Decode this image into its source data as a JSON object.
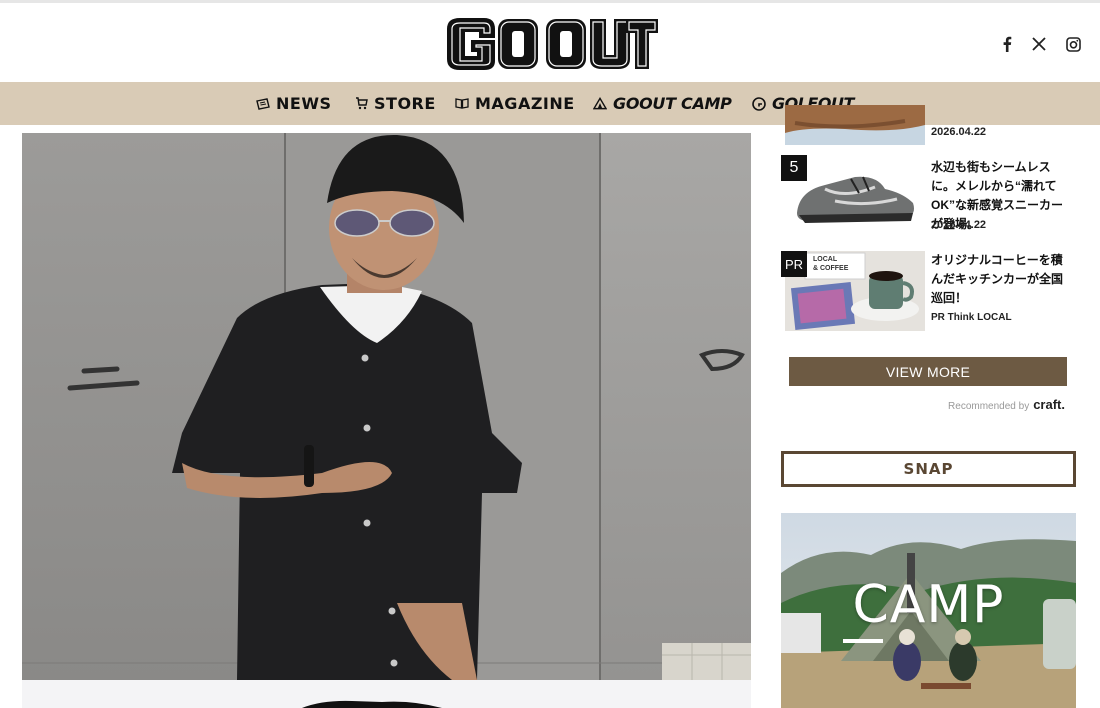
{
  "site": {
    "logo_text": "GO OUT"
  },
  "social": {
    "facebook_icon": "facebook-icon",
    "x_icon": "x-icon",
    "instagram_icon": "instagram-icon"
  },
  "nav": {
    "items": [
      {
        "label": "NEWS",
        "icon": "news-icon"
      },
      {
        "label": "STORE",
        "icon": "cart-icon"
      },
      {
        "label": "MAGAZINE",
        "icon": "book-icon"
      },
      {
        "label": "GOOUT CAMP",
        "icon": "tent-icon"
      },
      {
        "label": "GOLFOUT",
        "icon": "golf-icon"
      }
    ]
  },
  "ranking": {
    "items": [
      {
        "rank": "",
        "title": "",
        "date": "2026.04.22"
      },
      {
        "rank": "5",
        "title": "水辺も街もシームレスに。メレルから“濡れてOK”な新感覚スニーカーが登場。",
        "date": "2026.04.22"
      },
      {
        "rank": "PR",
        "title": "オリジナルコーヒーを積んだキッチンカーが全国巡回！",
        "sponsor": "PR Think LOCAL"
      }
    ],
    "thumb_text": "LOCAL\n& COFFEE"
  },
  "sidebar": {
    "view_more": "VIEW MORE",
    "recommended_by": "Recommended by",
    "craft": "craft.",
    "snap": "SNAP",
    "camp_banner": "CAMP"
  },
  "colors": {
    "nav_bg": "#d9cbb6",
    "accent_brown": "#6d5a43",
    "snap_border": "#5a4733"
  }
}
